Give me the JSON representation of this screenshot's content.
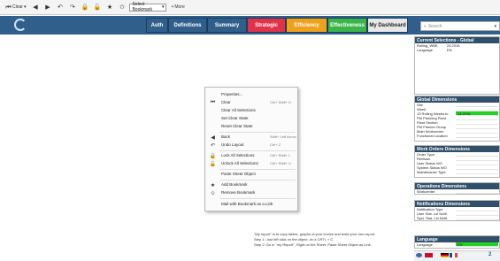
{
  "toolbar": {
    "clear_label": "Clear",
    "bookmark_select": "Select Bookmark",
    "more_label": "More"
  },
  "tabs": [
    {
      "label": "Auth",
      "color": "#2f5f8a"
    },
    {
      "label": "Definitions",
      "color": "#2f5f8a"
    },
    {
      "label": "Summary",
      "color": "#2f5f8a"
    },
    {
      "label": "Strategic",
      "color": "#e0324a"
    },
    {
      "label": "Efficiency",
      "color": "#f0a11c"
    },
    {
      "label": "Effectiveness",
      "color": "#3bb54a"
    },
    {
      "label": "My Dashboard",
      "color": "#e8e8e8"
    }
  ],
  "search": {
    "placeholder": "Search"
  },
  "context_menu": {
    "items": [
      {
        "label": "Properties...",
        "shortcut": "",
        "icon": ""
      },
      {
        "label": "Clear",
        "shortcut": "Ctrl+ Shift+ D",
        "icon": "clear-icon"
      },
      {
        "label": "Clear All Selections",
        "shortcut": "",
        "icon": ""
      },
      {
        "label": "Set Clear State",
        "shortcut": "",
        "icon": ""
      },
      {
        "label": "Reset Clear State",
        "shortcut": "",
        "icon": ""
      },
      {
        "label": "Back",
        "shortcut": "Shift+ Left Arrow",
        "icon": "back-icon"
      },
      {
        "label": "Undo Layout",
        "shortcut": "Ctrl+ Z",
        "icon": "undo-icon"
      },
      {
        "label": "Lock All Selections",
        "shortcut": "Ctrl+ Shift+ L",
        "icon": "lock-icon"
      },
      {
        "label": "Unlock All Selections",
        "shortcut": "Ctrl+ Shift+ U",
        "icon": "unlock-icon"
      },
      {
        "label": "Paste Sheet Object",
        "shortcut": "",
        "icon": ""
      },
      {
        "label": "Add Bookmark",
        "shortcut": "",
        "icon": "add-bookmark-icon"
      },
      {
        "label": "Remove Bookmark",
        "shortcut": "",
        "icon": "remove-bookmark-icon"
      },
      {
        "label": "Mail with Bookmark as a Link",
        "shortcut": "",
        "icon": ""
      }
    ]
  },
  "note": {
    "line1": "\"My report\" is to copy tables, graphs of your choice and build your own report.",
    "line2": "Step 1: Just left click on the object, do a CRTL + C.",
    "line3": "Step 2: Go in \"my Report\", Right on the Sheet, Paste Sheet Object as Link."
  },
  "panels": {
    "current": {
      "title": "Current Selections - Global",
      "rows": [
        {
          "label": "Rolling_WBE",
          "value": "24.2016"
        },
        {
          "label": "Language",
          "value": "EN"
        }
      ]
    },
    "global": {
      "title": "Global Dimensions",
      "rows": [
        {
          "label": "Site",
          "value": ""
        },
        {
          "label": "Week",
          "value": ""
        },
        {
          "label": "13 Rolling Weeks to",
          "value": "24.2016"
        },
        {
          "label": "PM Planning Plant",
          "value": ""
        },
        {
          "label": "Plant Section",
          "value": ""
        },
        {
          "label": "PM Planner Group",
          "value": ""
        },
        {
          "label": "Main Workcenter",
          "value": ""
        },
        {
          "label": "Functional Location",
          "value": ""
        }
      ]
    },
    "work_orders": {
      "title": "Work Orders Dimensions",
      "rows": [
        {
          "label": "Order Type",
          "value": ""
        },
        {
          "label": "Revision",
          "value": ""
        },
        {
          "label": "User Status WO",
          "value": ""
        },
        {
          "label": "System Status WO",
          "value": ""
        },
        {
          "label": "Maintenance Type",
          "value": ""
        }
      ]
    },
    "operations": {
      "title": "Operations Dimensions",
      "rows": [
        {
          "label": "Workcenter",
          "value": ""
        }
      ]
    },
    "notifications": {
      "title": "Notifications Dimensions",
      "rows": [
        {
          "label": "Notification Type",
          "value": ""
        },
        {
          "label": "User Stat. Lst Notif.",
          "value": ""
        },
        {
          "label": "Syst. Stat. Lst Notif.",
          "value": ""
        }
      ]
    },
    "language": {
      "title": "Language",
      "rows": [
        {
          "label": "Language",
          "value": "EN"
        }
      ]
    }
  },
  "bottom": {
    "page_number": "2"
  }
}
